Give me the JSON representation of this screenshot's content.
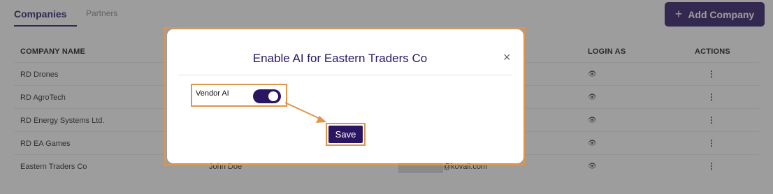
{
  "tabs": {
    "active": "Companies",
    "inactive": "Partners"
  },
  "add_button": {
    "label": "Add Company",
    "icon": "plus-icon"
  },
  "table": {
    "headers": {
      "company": "COMPANY NAME",
      "login": "LOGIN AS",
      "actions": "ACTIONS"
    },
    "rows": [
      {
        "name": "RD Drones"
      },
      {
        "name": "RD AgroTech"
      },
      {
        "name": "RD Energy Systems Ltd."
      },
      {
        "name": "RD EA Games"
      },
      {
        "name": "Eastern Traders Co",
        "contact": "John Doe",
        "email": "@kovali.com"
      }
    ],
    "login_icon": "eye-icon",
    "action_icon": "kebab-menu-icon"
  },
  "modal": {
    "title": "Enable AI for Eastern Traders Co",
    "close_glyph": "×",
    "vendor_label": "Vendor AI",
    "vendor_enabled": true,
    "save_label": "Save",
    "annotation_color": "#e0954a"
  },
  "colors": {
    "brand": "#2a1563",
    "annotation": "#e0954a"
  }
}
